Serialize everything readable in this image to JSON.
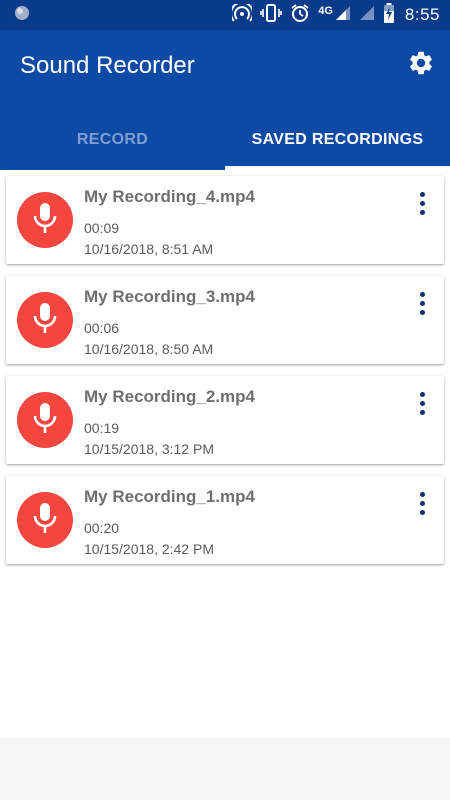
{
  "status_bar": {
    "network": "4G",
    "time": "8:55"
  },
  "app_bar": {
    "title": "Sound Recorder",
    "settings_icon": "gear-icon"
  },
  "tabs": [
    {
      "label": "RECORD",
      "active": false
    },
    {
      "label": "SAVED RECORDINGS",
      "active": true
    }
  ],
  "recordings": [
    {
      "name": "My Recording_4.mp4",
      "duration": "00:09",
      "date": "10/16/2018, 8:51 AM"
    },
    {
      "name": "My Recording_3.mp4",
      "duration": "00:06",
      "date": "10/16/2018, 8:50 AM"
    },
    {
      "name": "My Recording_2.mp4",
      "duration": "00:19",
      "date": "10/15/2018, 3:12 PM"
    },
    {
      "name": "My Recording_1.mp4",
      "duration": "00:20",
      "date": "10/15/2018, 2:42 PM"
    }
  ],
  "colors": {
    "status_bar": "#0a3a8a",
    "app_bar": "#0d4aa6",
    "mic_accent": "#f2463f",
    "menu_dots": "#0d2f73"
  }
}
